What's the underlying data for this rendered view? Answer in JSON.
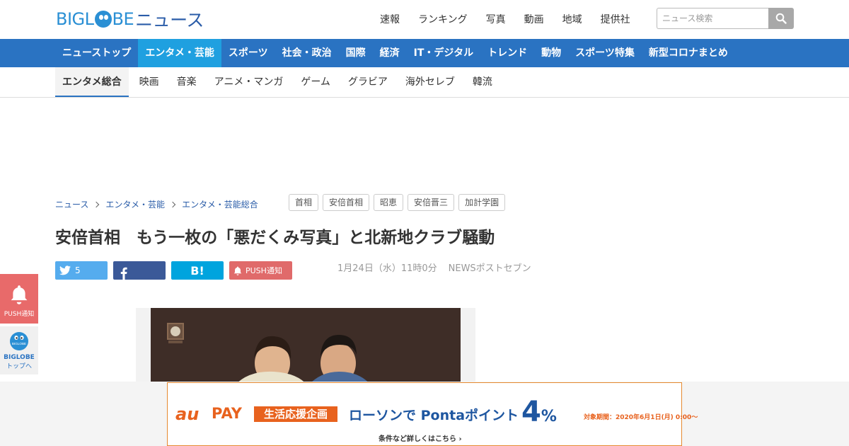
{
  "header": {
    "logo_brand": "BIGL",
    "logo_brand_end": "BE",
    "logo_news": "ニュース",
    "top_links": [
      "速報",
      "ランキング",
      "写真",
      "動画",
      "地域",
      "提供社"
    ],
    "search_placeholder": "ニュース検索"
  },
  "main_nav": {
    "items": [
      "ニューストップ",
      "エンタメ・芸能",
      "スポーツ",
      "社会・政治",
      "国際",
      "経済",
      "IT・デジタル",
      "トレンド",
      "動物",
      "スポーツ特集",
      "新型コロナまとめ"
    ],
    "active": "エンタメ・芸能"
  },
  "sub_nav": {
    "items": [
      "エンタメ総合",
      "映画",
      "音楽",
      "アニメ・マンガ",
      "ゲーム",
      "グラビア",
      "海外セレブ",
      "韓流"
    ],
    "active": "エンタメ総合"
  },
  "breadcrumb": [
    "ニュース",
    "エンタメ・芸能",
    "エンタメ・芸能総合"
  ],
  "tags": [
    "首相",
    "安倍首相",
    "昭恵",
    "安倍晋三",
    "加計学園"
  ],
  "article": {
    "title": "安倍首相　もう一枚の「悪だくみ写真」と北新地クラブ騒動",
    "date": "1月24日（水）11時0分",
    "source": "NEWSポストセブン"
  },
  "share": {
    "twitter_count": "5",
    "hatena_label": "B!",
    "push_label": "PUSH通知"
  },
  "float": {
    "push_label": "PUSH通知",
    "top_brand": "BIGLOBE",
    "top_label": "トップへ",
    "logo_text": "BIGLOBE"
  },
  "ad": {
    "au": "au",
    "pay": "PAY",
    "plan": "生活応援企画",
    "lawson": "ローソンで Pontaポイント",
    "percent": "4",
    "percent_sign": "%",
    "period": "対象期間：2020年6月1日(月) 0:00〜",
    "detail": "条件など詳しくはこちら ›"
  },
  "colors": {
    "nav_blue": "#2a73c2",
    "nav_active": "#1fa0e0",
    "push_red": "#e06a6a",
    "au_orange": "#e8621e"
  }
}
